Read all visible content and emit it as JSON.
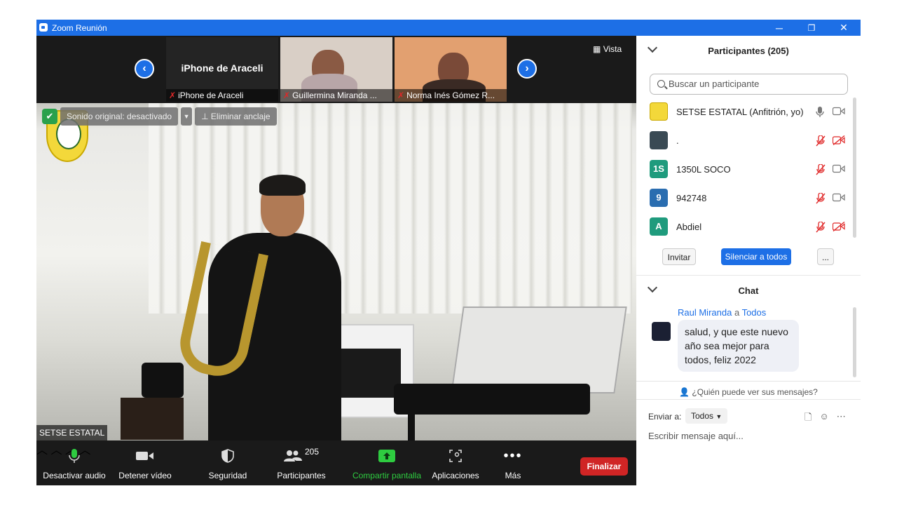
{
  "window": {
    "title": "Zoom Reunión",
    "minimize": "─",
    "restore": "❐",
    "close": "✕"
  },
  "colors": {
    "accent": "#1d6fe6",
    "end": "#d02525",
    "share": "#2ecc40",
    "muted": "#e02828"
  },
  "strip": {
    "prev_arrow": "‹",
    "next_arrow": "›",
    "thumbnails": [
      {
        "center_name": "iPhone de Araceli",
        "label": "iPhone de Araceli"
      },
      {
        "label": "Guillermina Miranda ..."
      },
      {
        "label": "Norma Inés Gómez R..."
      }
    ],
    "vista": "Vista"
  },
  "main_video": {
    "original_sound": "Sonido original: desactivado",
    "unpin": "Eliminar anclaje",
    "speaker_name": "SETSE ESTATAL"
  },
  "toolbar": {
    "mute": "Desactivar audio",
    "video": "Detener vídeo",
    "security": "Seguridad",
    "participants": "Participantes",
    "participants_count": "205",
    "share": "Compartir pantalla",
    "apps": "Aplicaciones",
    "more": "Más",
    "end": "Finalizar"
  },
  "participants_panel": {
    "title": "Participantes (205)",
    "search_placeholder": "Buscar un participante",
    "list": [
      {
        "avatar": "",
        "name": "SETSE ESTATAL (Anfitrión, yo)",
        "avatar_color": "#f3d83a"
      },
      {
        "avatar": "",
        "name": ".",
        "avatar_color": "#3a4a54"
      },
      {
        "avatar": "1S",
        "name": "1350L SOCO",
        "avatar_color": "#1f9b7d"
      },
      {
        "avatar": "9",
        "name": "942748",
        "avatar_color": "#2a6db0"
      },
      {
        "avatar": "A",
        "name": "Abdiel",
        "avatar_color": "#1f9b7d"
      }
    ],
    "invite": "Invitar",
    "mute_all": "Silenciar a todos",
    "more": "..."
  },
  "chat_panel": {
    "title": "Chat",
    "sender": "Raul Miranda",
    "to_word": "a",
    "recipient": "Todos",
    "message": "salud, y que este nuevo año sea mejor para todos, feliz 2022",
    "who_can_see": "¿Quién puede ver sus mensajes?",
    "send_to_label": "Enviar a:",
    "send_to_value": "Todos",
    "input_placeholder": "Escribir mensaje aquí..."
  }
}
